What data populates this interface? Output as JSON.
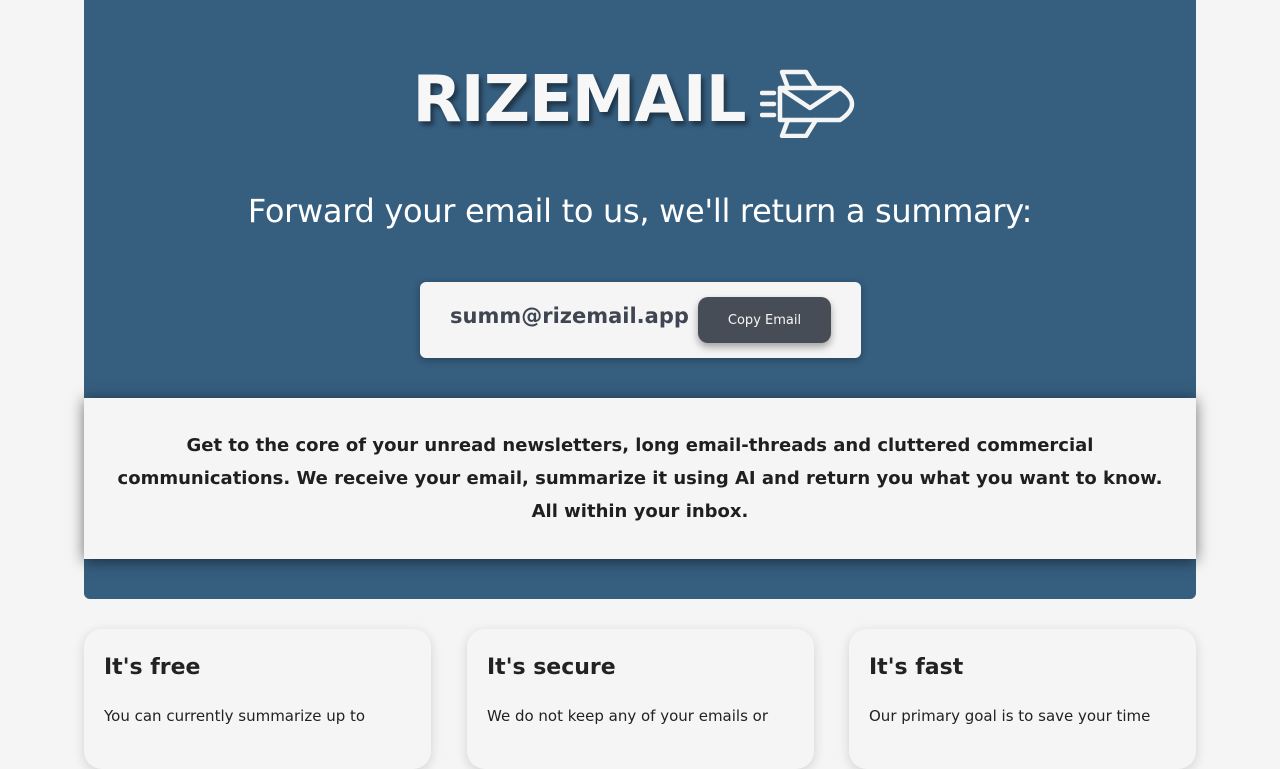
{
  "hero": {
    "brand_name": "RIZEMAIL",
    "logo_icon": "rocket-envelope-icon",
    "tagline": "Forward your email to us, we'll return a summary:",
    "email_address": "summ@rizemail.app",
    "copy_button_label": "Copy Email"
  },
  "description": "Get to the core of your unread newsletters, long email-threads and cluttered commercial communications. We receive your email, summarize it using AI and return you what you want to know. All within your inbox.",
  "features": [
    {
      "title": "It's free",
      "text": "You can currently summarize up to"
    },
    {
      "title": "It's secure",
      "text": "We do not keep any of your emails or"
    },
    {
      "title": "It's fast",
      "text": "Our primary goal is to save your time"
    }
  ],
  "colors": {
    "hero_background": "#365e7f",
    "page_background": "#f5f5f5",
    "button_background": "#474d57"
  }
}
